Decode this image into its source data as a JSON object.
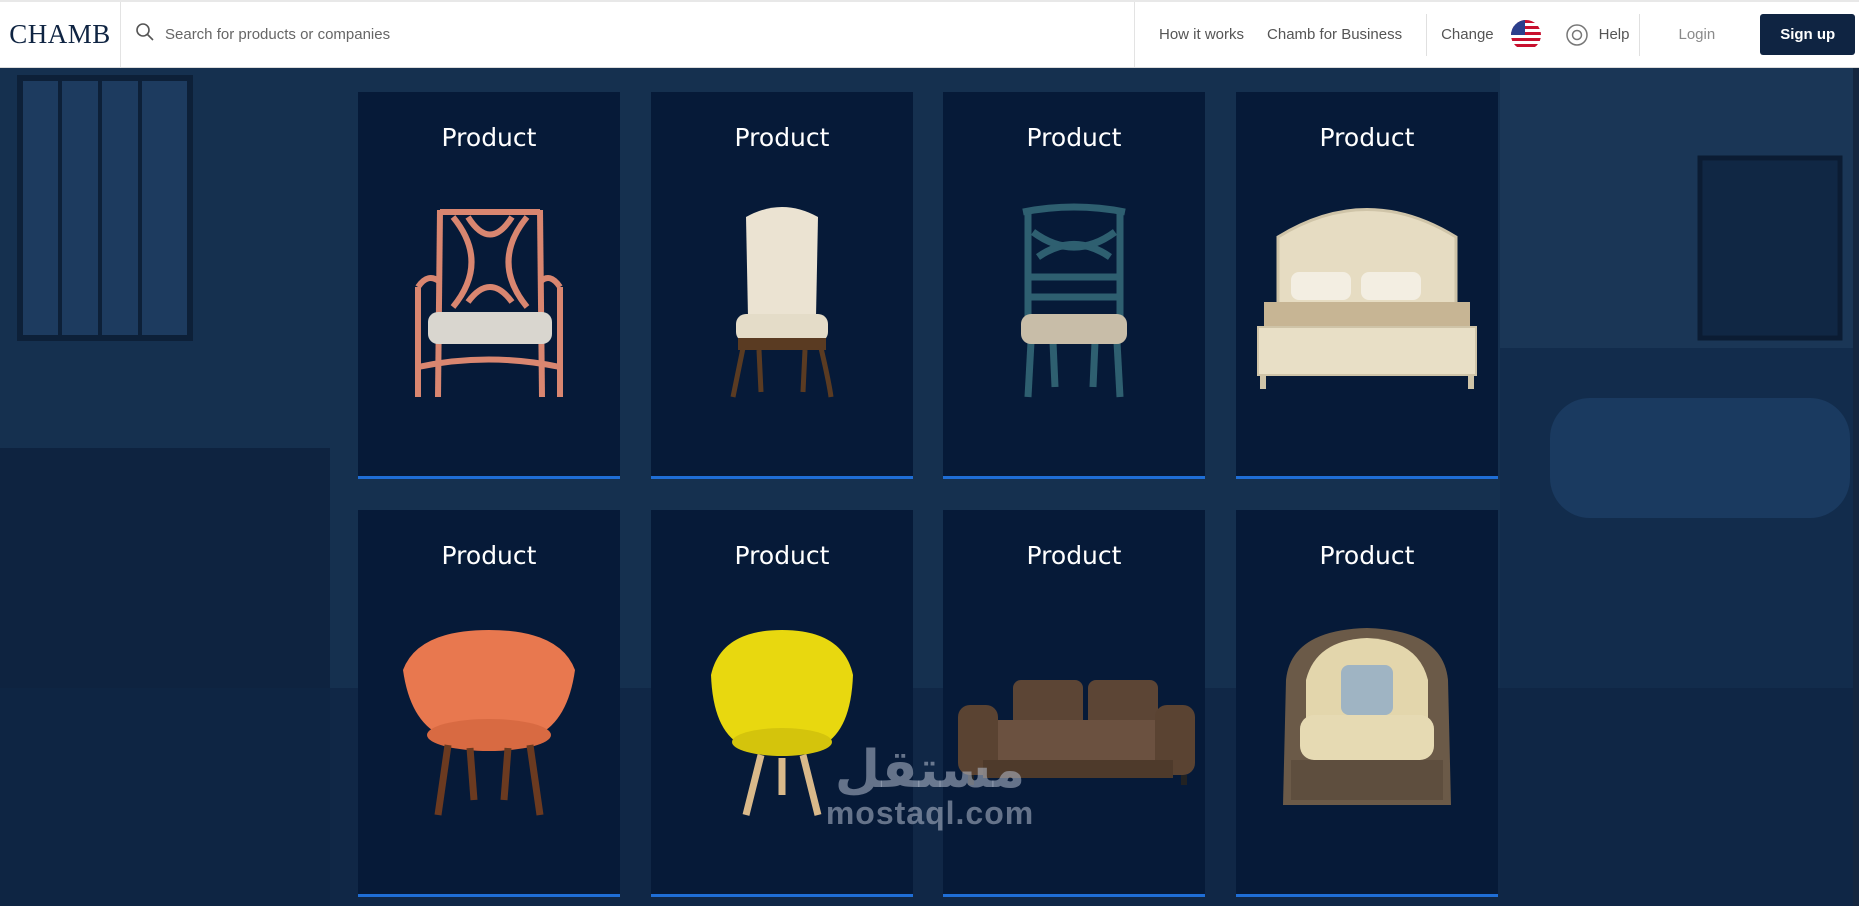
{
  "header": {
    "logo": "CHAMB",
    "search_placeholder": "Search for products or companies",
    "nav": {
      "how_it_works": "How it works",
      "business": "Chamb for Business",
      "change": "Change",
      "help": "Help",
      "login": "Login",
      "signup": "Sign up"
    }
  },
  "products": [
    {
      "title": "Product",
      "icon": "armchair-pink"
    },
    {
      "title": "Product",
      "icon": "chair-cream"
    },
    {
      "title": "Product",
      "icon": "chair-teal"
    },
    {
      "title": "Product",
      "icon": "bed-cream"
    },
    {
      "title": "Product",
      "icon": "armchair-orange"
    },
    {
      "title": "Product",
      "icon": "armchair-yellow"
    },
    {
      "title": "Product",
      "icon": "sofa-brown"
    },
    {
      "title": "Product",
      "icon": "armchair-wicker"
    }
  ],
  "watermark": {
    "arabic": "مستقل",
    "latin": "mostaql.com"
  },
  "colors": {
    "accent": "#1f6ed6",
    "brand": "#0f2442",
    "card": "#061a38"
  }
}
